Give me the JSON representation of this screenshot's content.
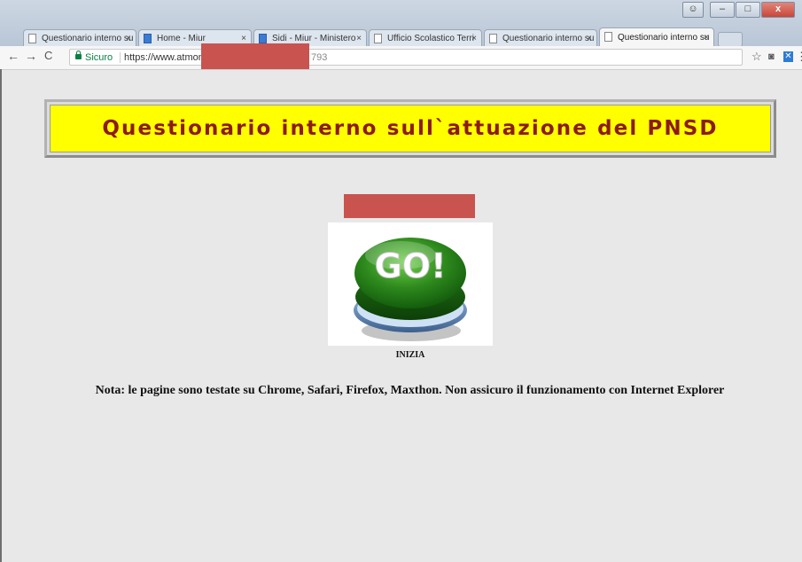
{
  "browser": {
    "tabs": [
      {
        "title": "Questionario interno su",
        "icon": "page-icon",
        "active": false
      },
      {
        "title": "Home - Miur",
        "icon": "miur-favicon-icon",
        "active": false
      },
      {
        "title": "Sidi - Miur - Ministero",
        "icon": "miur-favicon-icon",
        "active": false
      },
      {
        "title": "Ufficio Scolastico Terri",
        "icon": "page-icon",
        "active": false
      },
      {
        "title": "Questionario interno su",
        "icon": "page-icon",
        "active": false
      },
      {
        "title": "Questionario interno su",
        "icon": "page-icon",
        "active": true
      }
    ],
    "tab_close": "×",
    "nav": {
      "back": "←",
      "forward": "→",
      "reload": "C"
    },
    "address": {
      "secure_label": "Sicuro",
      "url_visible_start": "https://www.atmonz",
      "url_visible_end": "793"
    },
    "window_controls": {
      "minimize": "–",
      "maximize": "□",
      "close": "x"
    },
    "toolbar_icons": [
      "star-icon",
      "camera-icon",
      "extension-icon",
      "menu-icon"
    ],
    "toolbar_glyphs": {
      "star": "☆",
      "camera": "◙",
      "extension": "✕",
      "menu": "⋮"
    }
  },
  "page": {
    "title": "Questionario interno sull`attuazione del PNSD",
    "go_button_text": "GO!",
    "start_label": "INIZIA",
    "note": "Nota: le pagine sono testate su Chrome, Safari, Firefox, Maxthon. Non assicuro il funzionamento con Internet Explorer"
  },
  "colors": {
    "banner_bg": "#ffff00",
    "banner_text": "#8b1c12",
    "page_bg": "#e8e8e8",
    "redaction": "#c8534f",
    "go_button": "#2e8a1d"
  }
}
